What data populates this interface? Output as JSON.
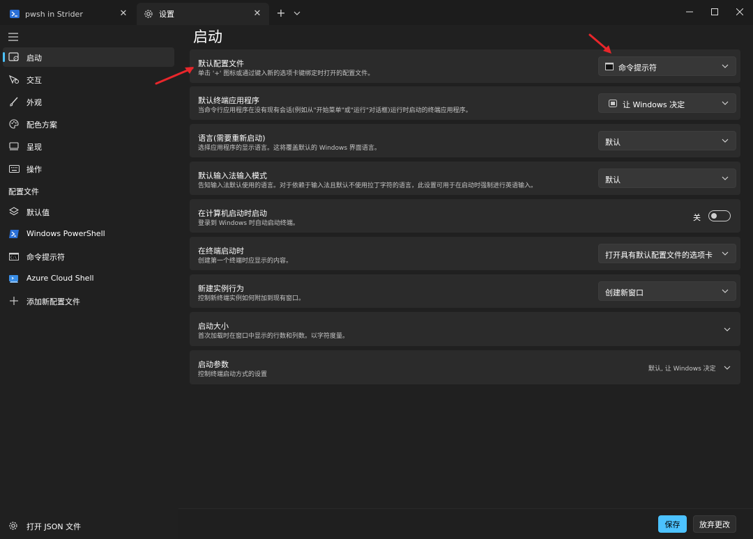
{
  "tabs": [
    {
      "label": "pwsh in Strider",
      "icon": "powershell-icon"
    },
    {
      "label": "设置",
      "icon": "gear-icon"
    }
  ],
  "colors": {
    "accent": "#4cc2ff",
    "background": "#202020",
    "card": "#2b2b2b",
    "annotation": "#e8262b"
  },
  "sidebar": {
    "items": [
      {
        "label": "启动",
        "icon": "launch-icon"
      },
      {
        "label": "交互",
        "icon": "interaction-icon"
      },
      {
        "label": "外观",
        "icon": "appearance-brush-icon"
      },
      {
        "label": "配色方案",
        "icon": "color-palette-icon"
      },
      {
        "label": "呈现",
        "icon": "rendering-monitor-icon"
      },
      {
        "label": "操作",
        "icon": "keyboard-icon"
      }
    ],
    "profiles_header": "配置文件",
    "profiles": [
      {
        "label": "默认值",
        "icon": "layers-icon"
      },
      {
        "label": "Windows PowerShell",
        "icon": "powershell-icon"
      },
      {
        "label": "命令提示符",
        "icon": "cmd-icon"
      },
      {
        "label": "Azure Cloud Shell",
        "icon": "azure-icon"
      },
      {
        "label": "添加新配置文件",
        "icon": "plus-icon"
      }
    ],
    "open_json": "打开 JSON 文件"
  },
  "page_title": "启动",
  "settings": [
    {
      "title": "默认配置文件",
      "desc": "单击 '+' 图标或通过键入新的选项卡键绑定时打开的配置文件。",
      "value": "命令提示符"
    },
    {
      "title": "默认终端应用程序",
      "desc": "当命令行应用程序在没有现有会话(例如从\"开始菜单\"或\"运行\"对话框)运行时启动的终端应用程序。",
      "value": "让 Windows 决定"
    },
    {
      "title": "语言(需要重新启动)",
      "desc": "选择应用程序的显示语言。这将覆盖默认的 Windows 界面语言。",
      "value": "默认"
    },
    {
      "title": "默认输入法输入模式",
      "desc": "告知输入法默认使用的语言。对于依赖于输入法且默认不使用拉丁字符的语言，此设置可用于在启动时强制进行英语输入。",
      "value": "默认"
    },
    {
      "title": "在计算机启动时启动",
      "desc": "登录到 Windows 时自动启动终端。",
      "toggle_label": "关",
      "toggle_on": false
    },
    {
      "title": "在终端启动时",
      "desc": "创建第一个终端时应显示的内容。",
      "value": "打开具有默认配置文件的选项卡"
    },
    {
      "title": "新建实例行为",
      "desc": "控制新终端实例如何附加到现有窗口。",
      "value": "创建新窗口"
    },
    {
      "title": "启动大小",
      "desc": "首次加载时在窗口中显示的行数和列数。以字符度量。"
    },
    {
      "title": "启动参数",
      "desc": "控制终端启动方式的设置",
      "value": "默认, 让 Windows 决定"
    }
  ],
  "buttons": {
    "save": "保存",
    "discard": "放弃更改"
  }
}
